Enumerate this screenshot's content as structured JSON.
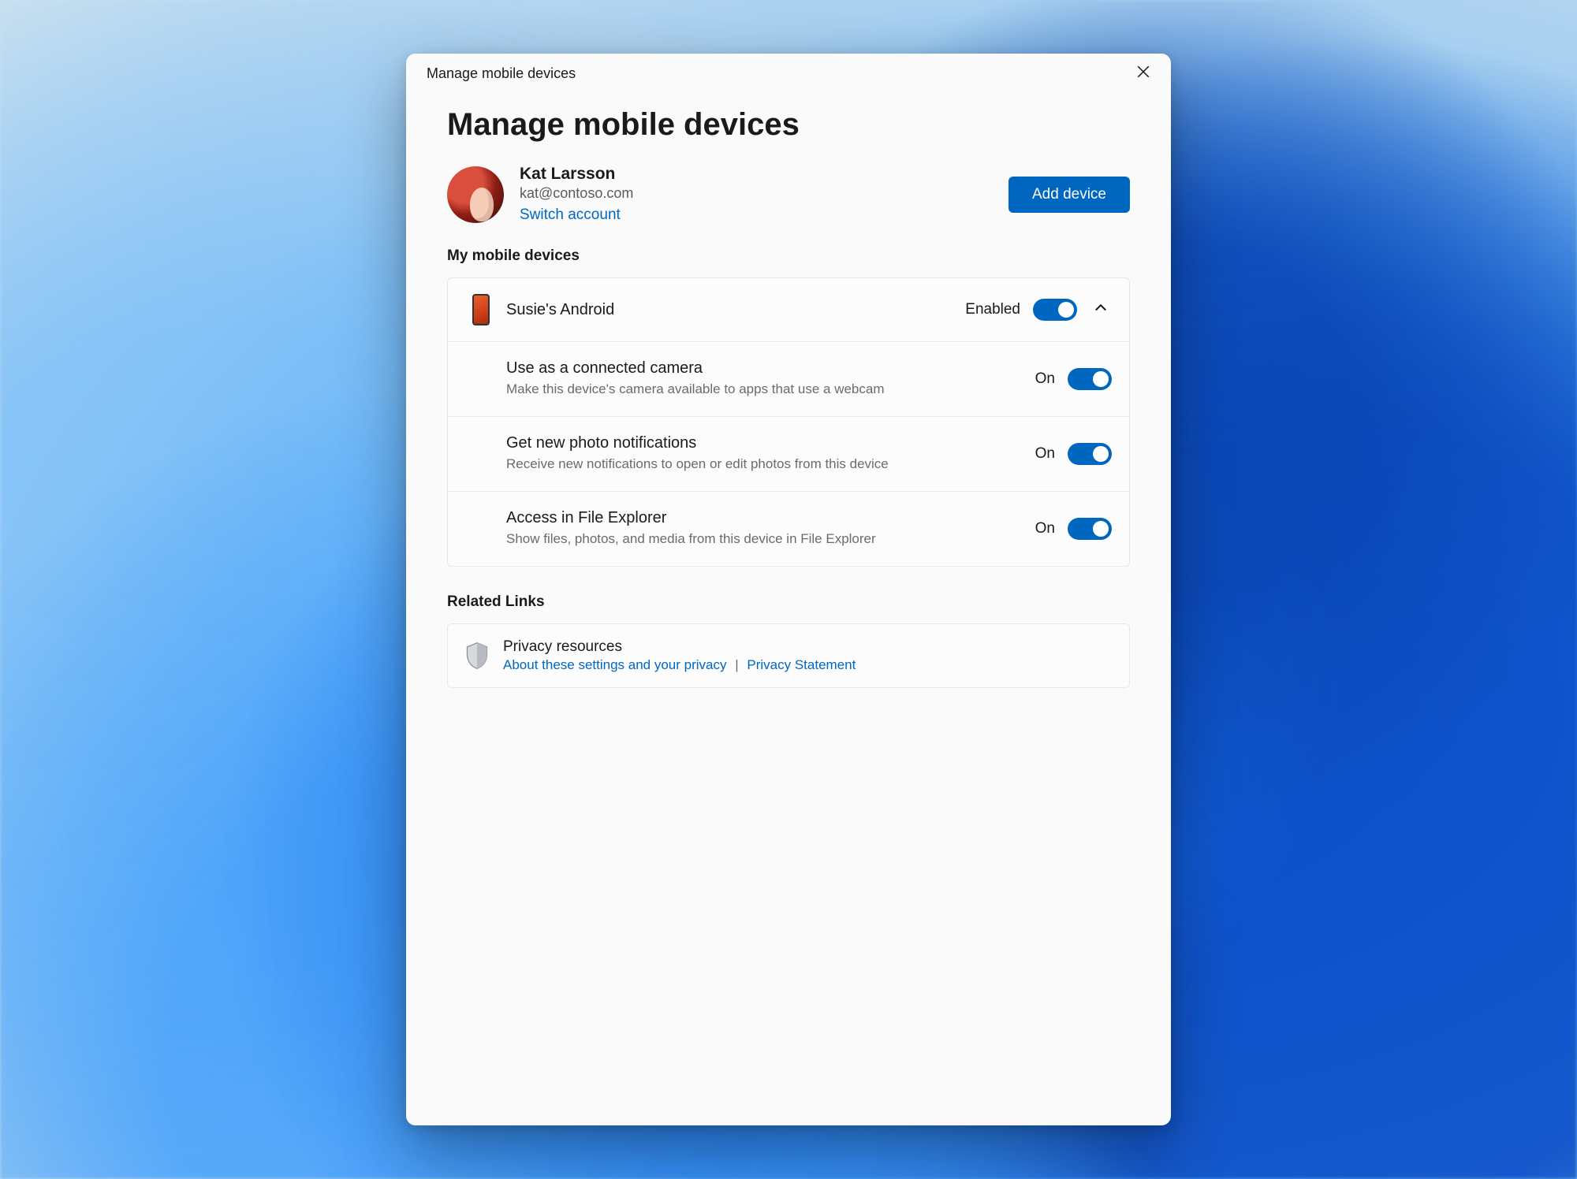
{
  "titlebar": {
    "title": "Manage mobile devices"
  },
  "page": {
    "heading": "Manage mobile devices"
  },
  "account": {
    "name": "Kat Larsson",
    "email": "kat@contoso.com",
    "switch_label": "Switch account",
    "add_button": "Add device"
  },
  "sections": {
    "devices_label": "My mobile devices",
    "related_label": "Related Links"
  },
  "device": {
    "name": "Susie's Android",
    "state_label": "Enabled",
    "settings": [
      {
        "title": "Use as a connected camera",
        "subtitle": "Make this device's camera available to apps that use a webcam",
        "state": "On"
      },
      {
        "title": "Get new photo notifications",
        "subtitle": "Receive new notifications to open or edit photos from this device",
        "state": "On"
      },
      {
        "title": "Access in File Explorer",
        "subtitle": "Show files, photos, and media from this device in File Explorer",
        "state": "On"
      }
    ]
  },
  "related": {
    "title": "Privacy resources",
    "link1": "About these settings and your privacy",
    "link2": "Privacy Statement"
  }
}
